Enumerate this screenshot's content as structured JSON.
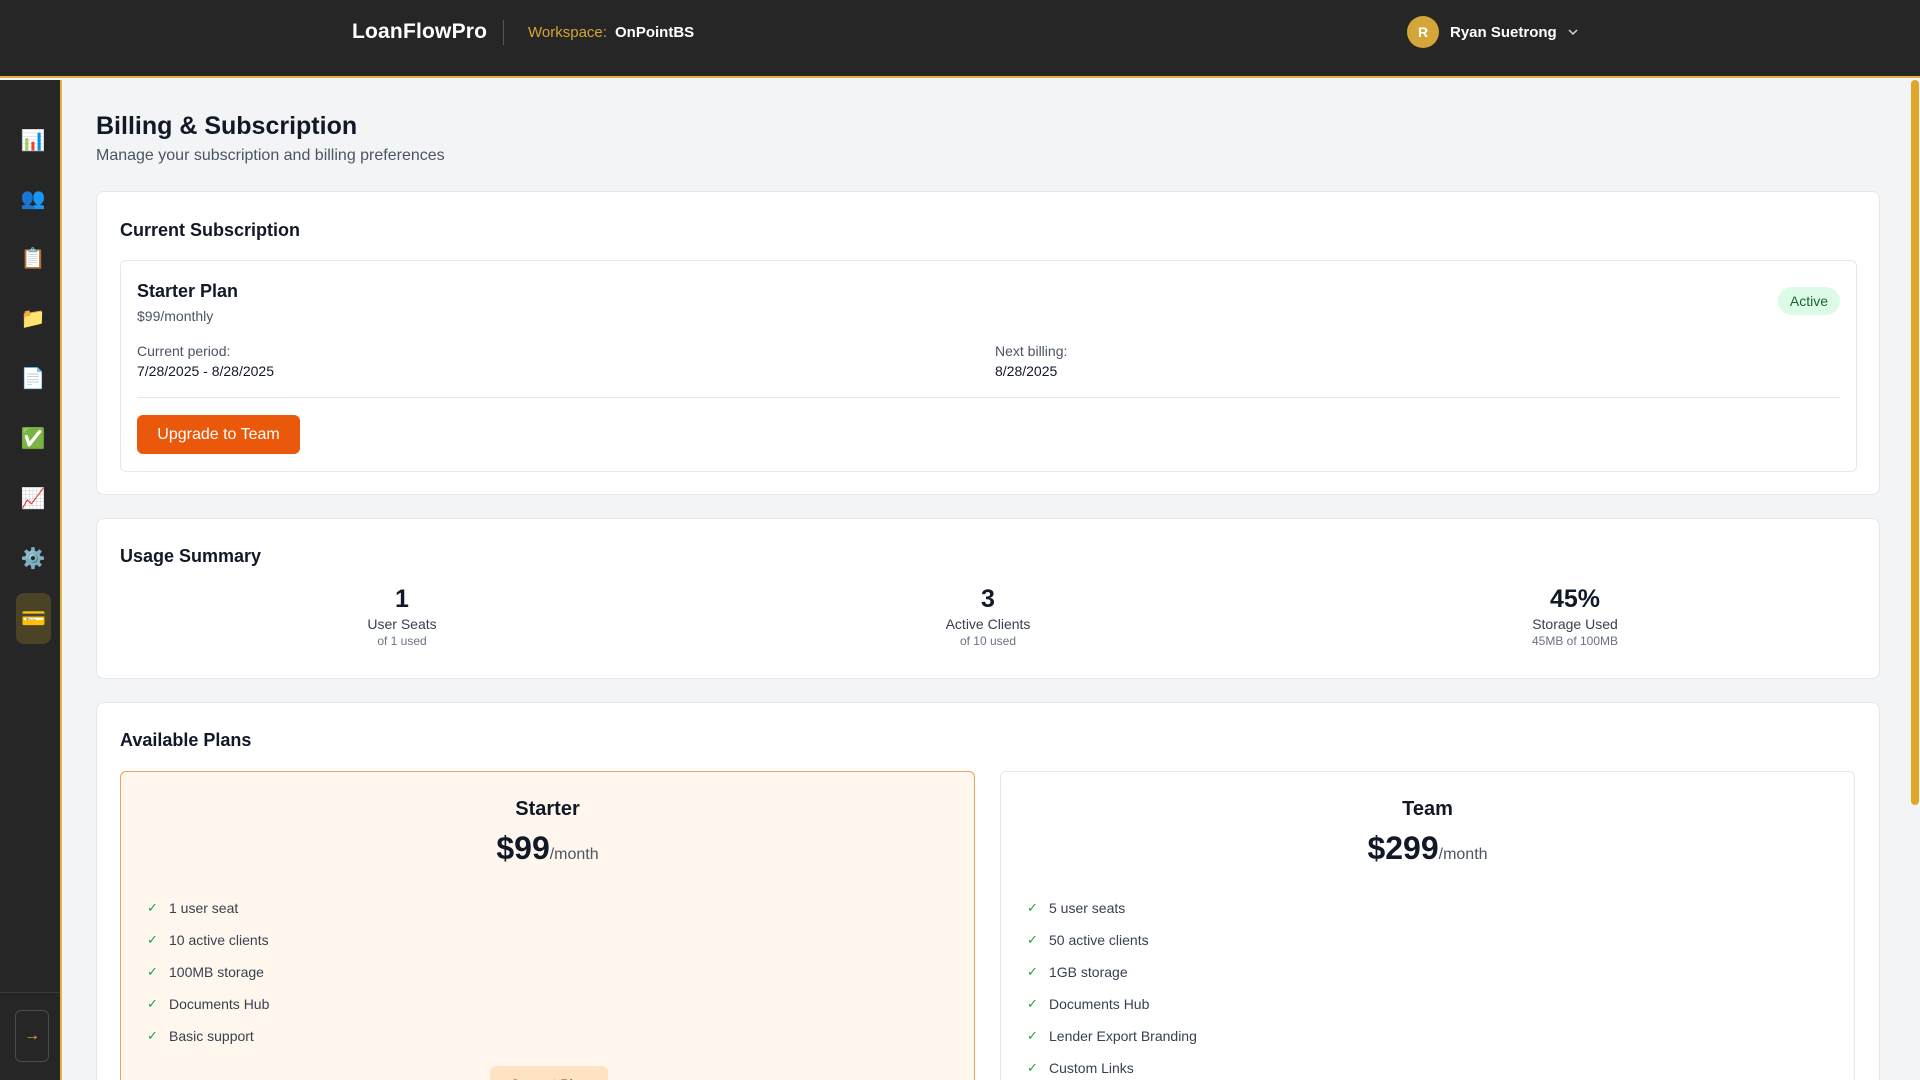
{
  "header": {
    "brand": "LoanFlowPro",
    "workspace_label": "Workspace:",
    "workspace_name": "OnPointBS",
    "user_initial": "R",
    "user_name": "Ryan Suetrong"
  },
  "sidebar": {
    "items": [
      {
        "name": "dashboard",
        "icon": "📊"
      },
      {
        "name": "clients",
        "icon": "👥"
      },
      {
        "name": "tasks",
        "icon": "📋"
      },
      {
        "name": "folders",
        "icon": "📁"
      },
      {
        "name": "documents",
        "icon": "📄"
      },
      {
        "name": "checklists",
        "icon": "✅"
      },
      {
        "name": "reports",
        "icon": "📈"
      },
      {
        "name": "settings",
        "icon": "⚙️"
      },
      {
        "name": "billing",
        "icon": "💳"
      }
    ],
    "collapse_icon": "→"
  },
  "page": {
    "title": "Billing & Subscription",
    "subtitle": "Manage your subscription and billing preferences"
  },
  "subscription": {
    "section_title": "Current Subscription",
    "plan_name": "Starter Plan",
    "price": "$99/monthly",
    "status": "Active",
    "period_label": "Current period:",
    "period_value": "7/28/2025 - 8/28/2025",
    "next_billing_label": "Next billing:",
    "next_billing_value": "8/28/2025",
    "upgrade_label": "Upgrade to Team"
  },
  "usage": {
    "section_title": "Usage Summary",
    "items": [
      {
        "value": "1",
        "label": "User Seats",
        "note": "of 1 used"
      },
      {
        "value": "3",
        "label": "Active Clients",
        "note": "of 10 used"
      },
      {
        "value": "45%",
        "label": "Storage Used",
        "note": "45MB of 100MB"
      }
    ]
  },
  "plans": {
    "section_title": "Available Plans",
    "items": [
      {
        "name": "Starter",
        "amount": "$99",
        "per": "/month",
        "features": [
          "1 user seat",
          "10 active clients",
          "100MB storage",
          "Documents Hub",
          "Basic support"
        ],
        "button_label": "Current Plan"
      },
      {
        "name": "Team",
        "amount": "$299",
        "per": "/month",
        "features": [
          "5 user seats",
          "50 active clients",
          "1GB storage",
          "Documents Hub",
          "Lender Export Branding",
          "Custom Links"
        ]
      }
    ]
  },
  "colors": {
    "accent_gold": "#e0b43c",
    "upgrade_orange": "#ea580c",
    "active_green": "#166534"
  }
}
